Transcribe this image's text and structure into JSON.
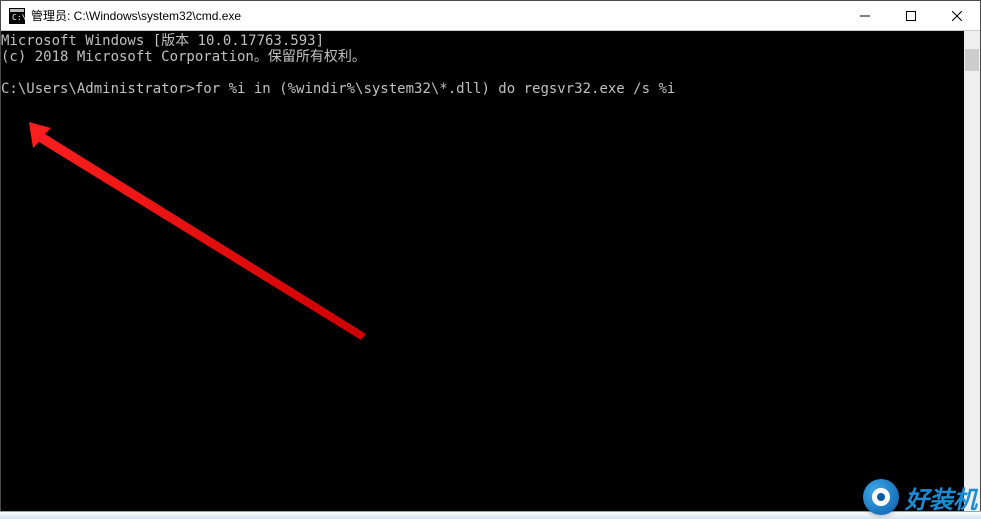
{
  "titlebar": {
    "title": "管理员: C:\\Windows\\system32\\cmd.exe"
  },
  "window_controls": {
    "minimize": "minimize",
    "maximize": "maximize",
    "close": "close"
  },
  "console": {
    "line1": "Microsoft Windows [版本 10.0.17763.593]",
    "line2": "(c) 2018 Microsoft Corporation。保留所有权利。",
    "blank": "",
    "prompt": "C:\\Users\\Administrator>",
    "command": "for %i in (%windir%\\system32\\*.dll) do regsvr32.exe /s %i"
  },
  "watermark": {
    "text": "好装机"
  }
}
